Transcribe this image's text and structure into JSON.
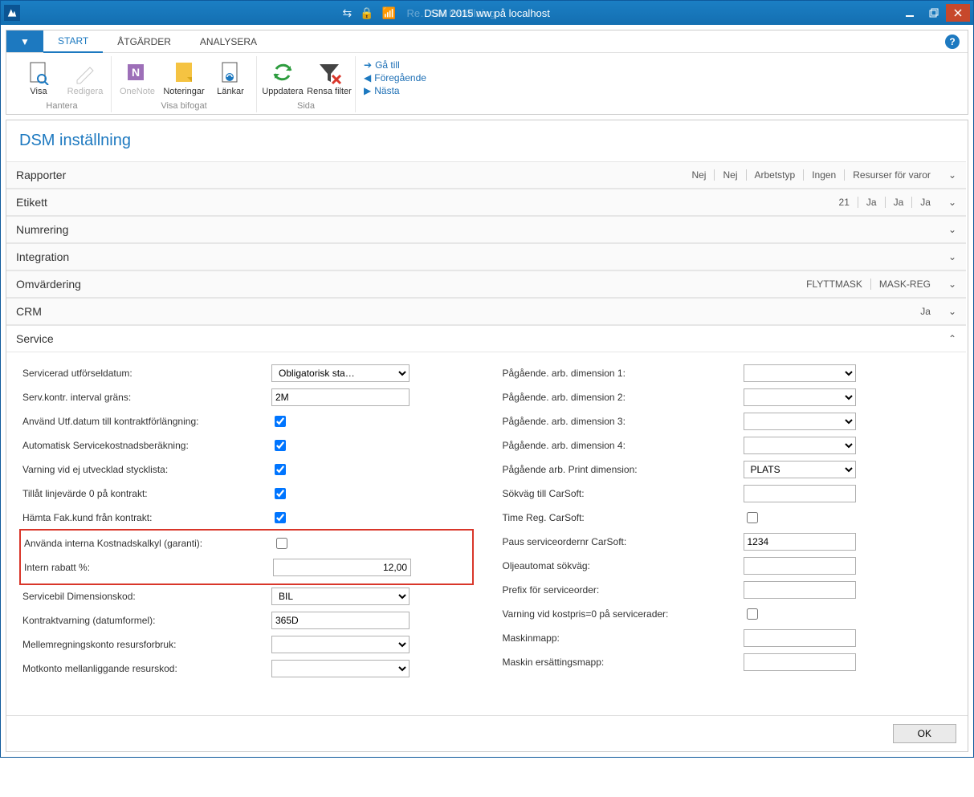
{
  "window": {
    "title": "DSM 2015 ww på localhost",
    "faded_title": "Re…SM inställning"
  },
  "tabs": {
    "start": "START",
    "actions": "ÅTGÄRDER",
    "analyze": "ANALYSERA"
  },
  "ribbon": {
    "groups": {
      "manage": "Hantera",
      "attached": "Visa bifogat",
      "page": "Sida"
    },
    "buttons": {
      "show": "Visa",
      "edit": "Redigera",
      "onenote": "OneNote",
      "notes": "Noteringar",
      "links": "Länkar",
      "refresh": "Uppdatera",
      "clear_filter": "Rensa filter",
      "goto": "Gå till",
      "prev": "Föregående",
      "next": "Nästa"
    }
  },
  "page": {
    "title": "DSM inställning"
  },
  "sections": {
    "rapporter": {
      "title": "Rapporter",
      "summary": [
        "Nej",
        "Nej",
        "Arbetstyp",
        "Ingen",
        "Resurser för varor"
      ]
    },
    "etikett": {
      "title": "Etikett",
      "summary": [
        "21",
        "Ja",
        "Ja",
        "Ja"
      ]
    },
    "numrering": {
      "title": "Numrering"
    },
    "integration": {
      "title": "Integration"
    },
    "omvardering": {
      "title": "Omvärdering",
      "summary": [
        "FLYTTMASK",
        "MASK-REG"
      ]
    },
    "crm": {
      "title": "CRM",
      "summary": [
        "Ja"
      ]
    },
    "service": {
      "title": "Service"
    }
  },
  "service": {
    "left": {
      "servicerad_utforseldatum_label": "Servicerad utförseldatum:",
      "servicerad_utforseldatum_value": "Obligatorisk sta…",
      "servkontr_interval_label": "Serv.kontr. interval gräns:",
      "servkontr_interval_value": "2M",
      "anvand_utfdatum_label": "Använd Utf.datum till kontraktförlängning:",
      "anvand_utfdatum_checked": true,
      "autoservicekost_label": "Automatisk Servicekostnadsberäkning:",
      "autoservicekost_checked": true,
      "varning_stycklista_label": "Varning vid ej utvecklad stycklista:",
      "varning_stycklista_checked": true,
      "tillat_linjevarde_label": "Tillåt linjevärde 0 på kontrakt:",
      "tillat_linjevarde_checked": true,
      "hamta_fakkund_label": "Hämta Fak.kund från kontrakt:",
      "hamta_fakkund_checked": true,
      "anvanda_intern_kostkalkyl_label": "Använda interna Kostnadskalkyl (garanti):",
      "anvanda_intern_kostkalkyl_checked": false,
      "intern_rabatt_label": "Intern rabatt %:",
      "intern_rabatt_value": "12,00",
      "servicebil_dimkod_label": "Servicebil Dimensionskod:",
      "servicebil_dimkod_value": "BIL",
      "kontraktvarning_label": "Kontraktvarning (datumformel):",
      "kontraktvarning_value": "365D",
      "mellemregning_label": "Mellemregningskonto resursforbruk:",
      "mellemregning_value": "",
      "motkonto_label": "Motkonto mellanliggande resurskod:",
      "motkonto_value": ""
    },
    "right": {
      "dim1_label": "Pågående. arb. dimension 1:",
      "dim1_value": "",
      "dim2_label": "Pågående. arb. dimension 2:",
      "dim2_value": "",
      "dim3_label": "Pågående. arb. dimension 3:",
      "dim3_value": "",
      "dim4_label": "Pågående. arb. dimension 4:",
      "dim4_value": "",
      "print_dim_label": "Pågående arb. Print dimension:",
      "print_dim_value": "PLATS",
      "sokvag_carsoft_label": "Sökväg till CarSoft:",
      "sokvag_carsoft_value": "",
      "timereg_carsoft_label": "Time Reg. CarSoft:",
      "timereg_carsoft_checked": false,
      "paus_so_carsoft_label": "Paus serviceordernr CarSoft:",
      "paus_so_carsoft_value": "1234",
      "oljeautomat_label": "Oljeautomat sökväg:",
      "oljeautomat_value": "",
      "prefix_so_label": "Prefix för serviceorder:",
      "prefix_so_value": "",
      "varning_kostpris_label": "Varning vid kostpris=0 på servicerader:",
      "varning_kostpris_checked": false,
      "maskinmapp_label": "Maskinmapp:",
      "maskinmapp_value": "",
      "maskin_ers_label": "Maskin ersättingsmapp:",
      "maskin_ers_value": ""
    }
  },
  "footer": {
    "ok": "OK"
  }
}
